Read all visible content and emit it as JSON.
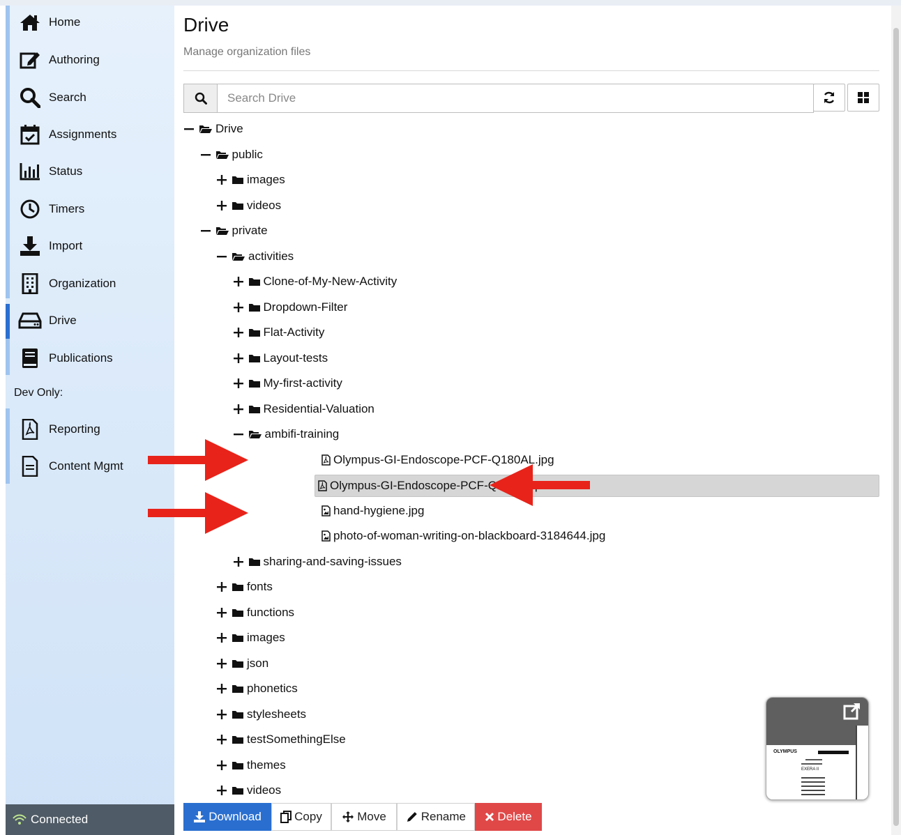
{
  "sidebar": {
    "items": [
      {
        "label": "Home",
        "icon": "home-icon"
      },
      {
        "label": "Authoring",
        "icon": "edit-icon"
      },
      {
        "label": "Search",
        "icon": "search-icon"
      },
      {
        "label": "Assignments",
        "icon": "calendar-check-icon"
      },
      {
        "label": "Status",
        "icon": "bar-chart-icon"
      },
      {
        "label": "Timers",
        "icon": "clock-icon"
      },
      {
        "label": "Import",
        "icon": "download-icon"
      },
      {
        "label": "Organization",
        "icon": "building-icon"
      },
      {
        "label": "Drive",
        "icon": "hard-drive-icon"
      },
      {
        "label": "Publications",
        "icon": "book-icon"
      }
    ],
    "dev_label": "Dev Only:",
    "dev_items": [
      {
        "label": "Reporting",
        "icon": "pdf-file-icon"
      },
      {
        "label": "Content Mgmt",
        "icon": "document-icon"
      }
    ],
    "status": "Connected",
    "active_item": "Drive"
  },
  "header": {
    "title": "Drive",
    "subtitle": "Manage organization files"
  },
  "search": {
    "placeholder": "Search Drive"
  },
  "tree": [
    {
      "label": "Drive",
      "type": "folder",
      "state": "expanded",
      "depth": 0
    },
    {
      "label": "public",
      "type": "folder",
      "state": "expanded",
      "depth": 1
    },
    {
      "label": "images",
      "type": "folder",
      "state": "collapsed",
      "depth": 2
    },
    {
      "label": "videos",
      "type": "folder",
      "state": "collapsed",
      "depth": 2
    },
    {
      "label": "private",
      "type": "folder",
      "state": "expanded",
      "depth": 1
    },
    {
      "label": "activities",
      "type": "folder",
      "state": "expanded",
      "depth": 2
    },
    {
      "label": "Clone-of-My-New-Activity",
      "type": "folder",
      "state": "collapsed",
      "depth": 3
    },
    {
      "label": "Dropdown-Filter",
      "type": "folder",
      "state": "collapsed",
      "depth": 3
    },
    {
      "label": "Flat-Activity",
      "type": "folder",
      "state": "collapsed",
      "depth": 3
    },
    {
      "label": "Layout-tests",
      "type": "folder",
      "state": "collapsed",
      "depth": 3
    },
    {
      "label": "My-first-activity",
      "type": "folder",
      "state": "collapsed",
      "depth": 3
    },
    {
      "label": "Residential-Valuation",
      "type": "folder",
      "state": "collapsed",
      "depth": 3
    },
    {
      "label": "ambifi-training",
      "type": "folder",
      "state": "expanded",
      "depth": 3
    },
    {
      "label": "Olympus-GI-Endoscope-PCF-Q180AL.jpg",
      "type": "pdf",
      "depth": 4
    },
    {
      "label": "Olympus-GI-Endoscope-PCF-Q180AL.pdf",
      "type": "pdf",
      "depth": 4,
      "selected": true
    },
    {
      "label": "hand-hygiene.jpg",
      "type": "image",
      "depth": 4
    },
    {
      "label": "photo-of-woman-writing-on-blackboard-3184644.jpg",
      "type": "image",
      "depth": 4
    },
    {
      "label": "sharing-and-saving-issues",
      "type": "folder",
      "state": "collapsed",
      "depth": 3
    },
    {
      "label": "fonts",
      "type": "folder",
      "state": "collapsed",
      "depth": 2
    },
    {
      "label": "functions",
      "type": "folder",
      "state": "collapsed",
      "depth": 2
    },
    {
      "label": "images",
      "type": "folder",
      "state": "collapsed",
      "depth": 2
    },
    {
      "label": "json",
      "type": "folder",
      "state": "collapsed",
      "depth": 2
    },
    {
      "label": "phonetics",
      "type": "folder",
      "state": "collapsed",
      "depth": 2
    },
    {
      "label": "stylesheets",
      "type": "folder",
      "state": "collapsed",
      "depth": 2
    },
    {
      "label": "testSomethingElse",
      "type": "folder",
      "state": "collapsed",
      "depth": 2
    },
    {
      "label": "themes",
      "type": "folder",
      "state": "collapsed",
      "depth": 2
    },
    {
      "label": "videos",
      "type": "folder",
      "state": "collapsed",
      "depth": 2
    }
  ],
  "actions": {
    "download": "Download",
    "copy": "Copy",
    "move": "Move",
    "rename": "Rename",
    "delete": "Delete"
  },
  "preview": {
    "brand_text": "OLYMPUS",
    "product_text": "EXERA II"
  },
  "colors": {
    "primary": "#2a6fd0",
    "danger": "#e04848",
    "arrow": "#e8231a",
    "selected_row": "#d6d6d6"
  }
}
